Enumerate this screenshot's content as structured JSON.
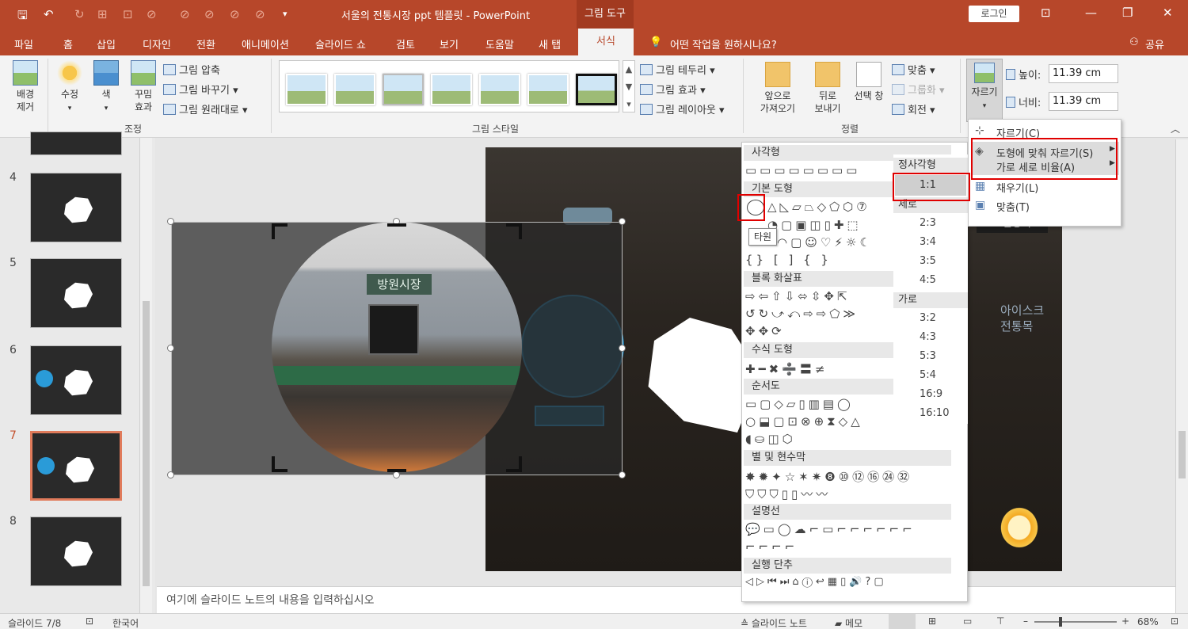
{
  "titlebar": {
    "doc_title": "서울의 전통시장 ppt 템플릿  -  PowerPoint",
    "tool_context": "그림 도구",
    "login": "로그인"
  },
  "tabs": [
    "파일",
    "홈",
    "삽입",
    "디자인",
    "전환",
    "애니메이션",
    "슬라이드 쇼",
    "검토",
    "보기",
    "도움말",
    "새 탭",
    "서식"
  ],
  "active_tab": "서식",
  "tell_me": "어떤 작업을 원하시나요?",
  "share": "공유",
  "ribbon": {
    "remove_bg": "배경\n제거",
    "adjust": {
      "corrections": "수정",
      "color": "색",
      "artistic": "꾸밈\n효과",
      "compress": "그림 압축",
      "change": "그림 바꾸기",
      "reset": "그림 원래대로",
      "group_label": "조정"
    },
    "styles": {
      "group_label": "그림 스타일",
      "border": "그림 테두리",
      "effects": "그림 효과",
      "layout": "그림 레이아웃"
    },
    "arrange": {
      "bring_forward": "앞으로\n가져오기",
      "send_backward": "뒤로\n보내기",
      "selection_pane": "선택 창",
      "align": "맞춤",
      "group": "그룹화",
      "rotate": "회전",
      "group_label": "정렬"
    },
    "size": {
      "crop": "자르기",
      "height_label": "높이:",
      "height_value": "11.39 cm",
      "width_label": "너비:",
      "width_value": "11.39 cm"
    }
  },
  "thumbnails": [
    {
      "num": "4"
    },
    {
      "num": "5"
    },
    {
      "num": "6"
    },
    {
      "num": "7",
      "active": true
    },
    {
      "num": "8"
    }
  ],
  "crop_menu": {
    "crop": "자르기(C)",
    "crop_to_shape": "도형에 맞춰 자르기(S)",
    "aspect_ratio": "가로 세로 비율(A)",
    "fill": "채우기(L)",
    "fit": "맞춤(T)"
  },
  "shape_menu": {
    "rect": "사각형",
    "basic": "기본 도형",
    "oval_tooltip": "타원",
    "block_arrows": "블록 화살표",
    "equation": "수식 도형",
    "flowchart": "순서도",
    "stars": "별 및 현수막",
    "callouts": "설명선",
    "action": "실행 단추"
  },
  "aspect_menu": {
    "square": "정사각형",
    "one_one": "1:1",
    "portrait": "세로",
    "p": [
      "2:3",
      "3:4",
      "3:5",
      "4:5"
    ],
    "landscape": "가로",
    "l": [
      "3:2",
      "4:3",
      "5:3",
      "5:4",
      "16:9",
      "16:10"
    ]
  },
  "notes_placeholder": "여기에 슬라이드 노트의 내용을 입력하십시오",
  "status": {
    "slide": "슬라이드 7/8",
    "lang": "한국어",
    "notes": "슬라이드 노트",
    "comments": "메모",
    "zoom": "68%"
  },
  "slide_text": {
    "market_sign": "방원시장",
    "shop_sign": "요한상회",
    "icecream": "아이스크\n전통목"
  },
  "colors": {
    "accent": "#b7472a",
    "highlight_red": "#e00000",
    "blue": "#2a9bd8"
  }
}
